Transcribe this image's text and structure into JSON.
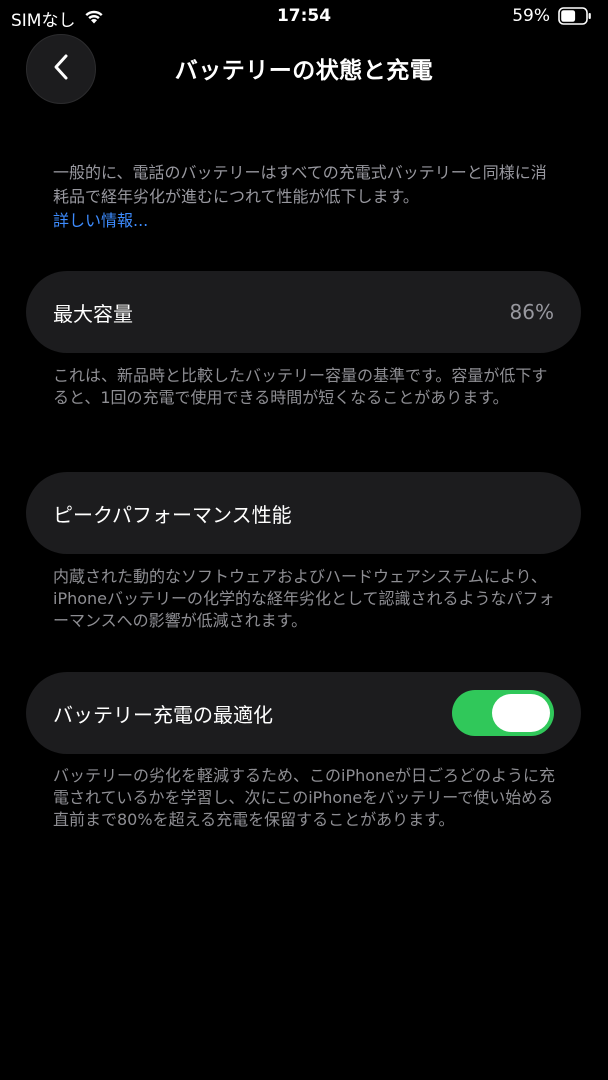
{
  "status_bar": {
    "carrier": "SIMなし",
    "time": "17:54",
    "battery_percent": "59%",
    "battery_level": 0.59,
    "wifi_icon": "wifi-icon",
    "battery_icon": "battery-icon"
  },
  "nav": {
    "back_icon": "chevron-left-icon",
    "title": "バッテリーの状態と充電"
  },
  "intro": {
    "text": "一般的に、電話のバッテリーはすべての充電式バッテリーと同様に消耗品で経年劣化が進むにつれて性能が低下します。",
    "link": "詳しい情報..."
  },
  "max_capacity": {
    "label": "最大容量",
    "value": "86%",
    "note": "これは、新品時と比較したバッテリー容量の基準です。容量が低下すると、1回の充電で使用できる時間が短くなることがあります。"
  },
  "peak_performance": {
    "label": "ピークパフォーマンス性能",
    "note": "内蔵された動的なソフトウェアおよびハードウェアシステムにより、iPhoneバッテリーの化学的な経年劣化として認識されるようなパフォーマンスへの影響が低減されます。"
  },
  "optimized_charging": {
    "label": "バッテリー充電の最適化",
    "enabled": true,
    "note": "バッテリーの劣化を軽減するため、このiPhoneが日ごろどのように充電されているかを学習し、次にこのiPhoneをバッテリーで使い始める直前まで80%を超える充電を保留することがあります。"
  },
  "colors": {
    "background": "#000000",
    "card": "#1c1c1e",
    "secondary_text": "#8e8e93",
    "link": "#3d8bfd",
    "toggle_on": "#30c85a"
  }
}
